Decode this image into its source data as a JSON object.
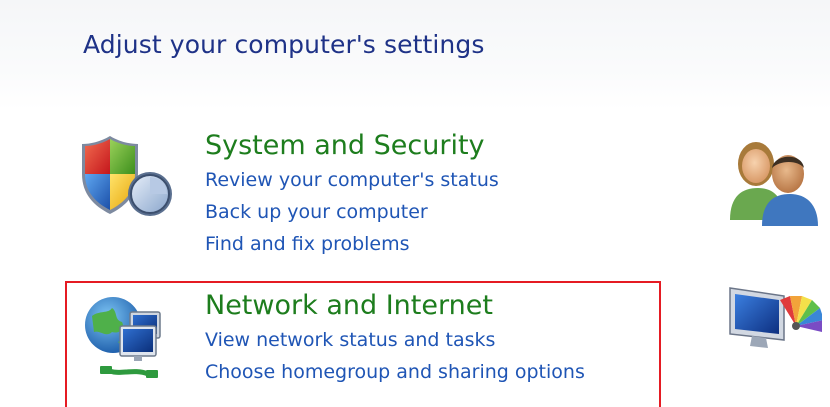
{
  "header": {
    "title": "Adjust your computer's settings"
  },
  "categories": [
    {
      "title": "System and Security",
      "icon": "shield-icon",
      "links": [
        "Review your computer's status",
        "Back up your computer",
        "Find and fix problems"
      ]
    },
    {
      "title": "Network and Internet",
      "icon": "network-globe-icon",
      "links": [
        "View network status and tasks",
        "Choose homegroup and sharing options"
      ],
      "highlighted": true
    }
  ],
  "right_column_icons": [
    "user-accounts-icon",
    "appearance-icon"
  ],
  "colors": {
    "title": "#1e3287",
    "category_title": "#1d7d1d",
    "link": "#1f55b5",
    "highlight_border": "#e51b23"
  }
}
